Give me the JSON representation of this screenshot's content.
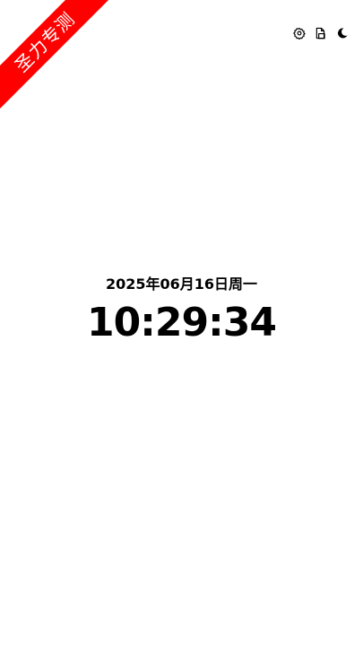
{
  "ribbon": {
    "text": "圣力专测",
    "color": "#ff0000"
  },
  "toolbar": {
    "icons": [
      "settings-gear-icon",
      "file-copy-icon",
      "moon-icon"
    ]
  },
  "clock": {
    "date": "2025年06月16日周一",
    "time": "10:29:34"
  }
}
